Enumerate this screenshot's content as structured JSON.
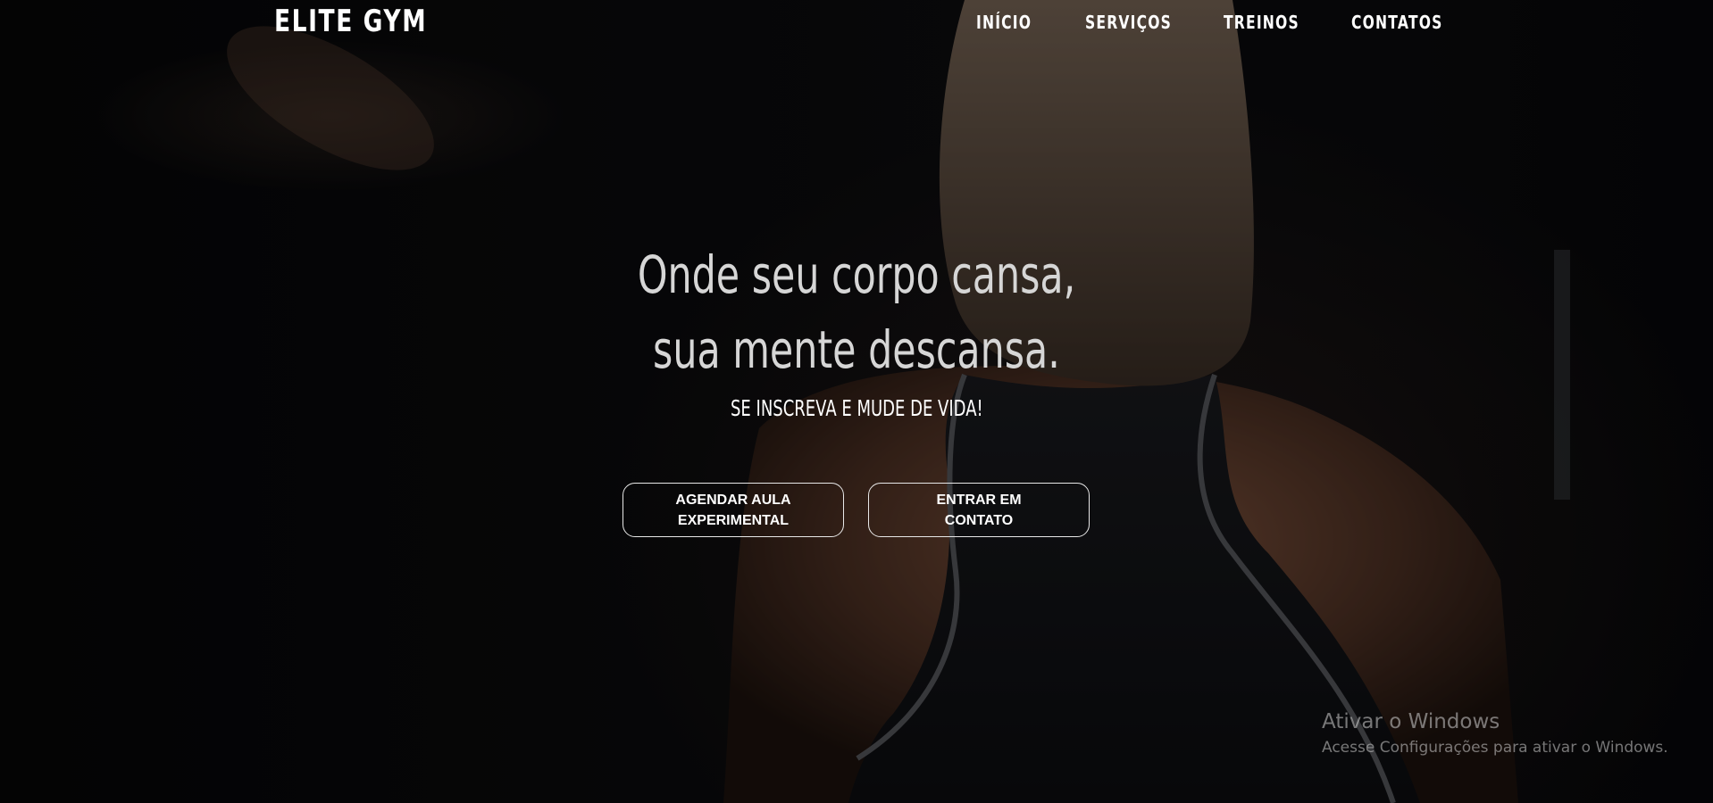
{
  "header": {
    "logo": "ELITE GYM",
    "nav": [
      "INÍCIO",
      "SERVIÇOS",
      "TREINOS",
      "CONTATOS"
    ]
  },
  "hero": {
    "headline_line1": "Onde seu corpo cansa,",
    "headline_line2": "sua mente descansa.",
    "subline": "SE INSCREVA E MUDE DE VIDA!",
    "buttons": {
      "schedule": "AGENDAR AULA EXPERIMENTAL",
      "contact": "ENTRAR EM CONTATO"
    }
  },
  "watermark": {
    "title": "Ativar o Windows",
    "subtitle": "Acesse Configurações para ativar o Windows."
  },
  "colors": {
    "background": "#0b0b0d",
    "text": "#ffffff",
    "headline": "#d6d6d6"
  }
}
